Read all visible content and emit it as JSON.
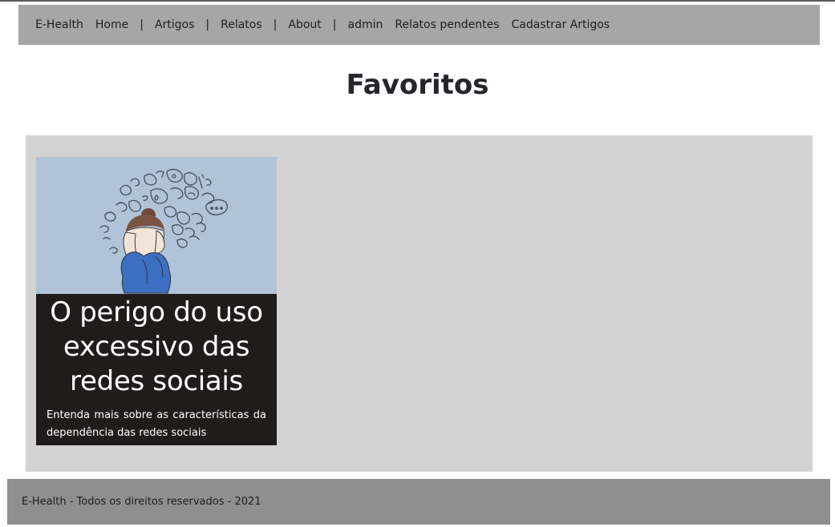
{
  "nav": {
    "brand": "E-Health",
    "home": "Home",
    "sep1": "|",
    "artigos": "Artigos",
    "sep2": "|",
    "relatos": "Relatos",
    "sep3": "|",
    "about": "About",
    "sep4": "|",
    "admin": "admin",
    "relatos_pendentes": "Relatos pendentes",
    "cadastrar_artigos": "Cadastrar Artigos"
  },
  "page": {
    "title": "Favoritos"
  },
  "favorites": [
    {
      "image_icon": "stressed-person-illustration",
      "title": "O perigo do uso excessivo das redes sociais",
      "description": "Entenda mais sobre as características da dependência das redes sociais"
    }
  ],
  "footer": {
    "text": "E-Health - Todos os direitos reservados - 2021"
  },
  "colors": {
    "navbar_bg": "#a6a6a6",
    "panel_bg": "#d3d3d3",
    "card_body_bg": "#201c1c",
    "card_image_bg": "#b0c3d8",
    "footer_bg": "#8f8f8f"
  }
}
